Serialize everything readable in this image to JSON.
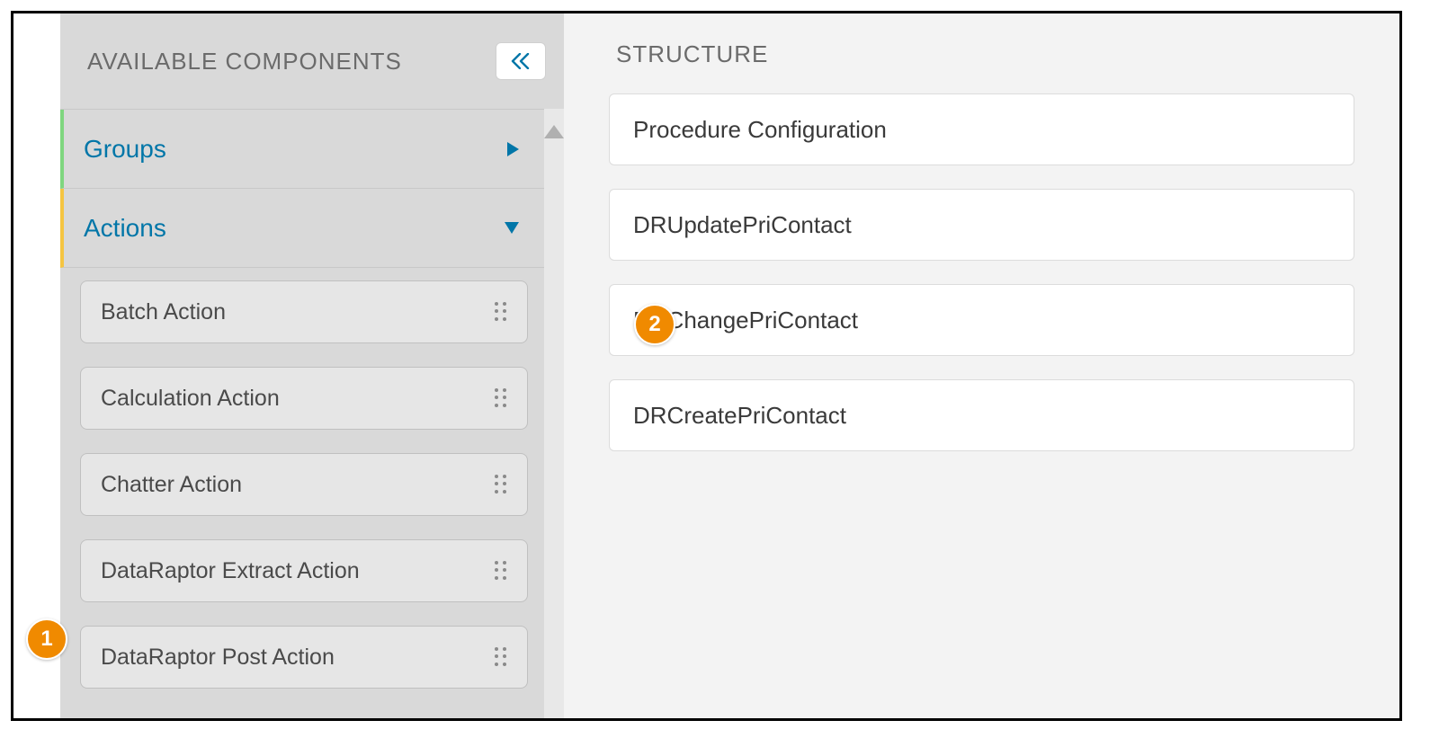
{
  "sidebar": {
    "title": "AVAILABLE COMPONENTS",
    "sections": {
      "groups": {
        "label": "Groups",
        "expanded": false
      },
      "actions": {
        "label": "Actions",
        "expanded": true,
        "items": [
          {
            "label": "Batch Action"
          },
          {
            "label": "Calculation Action"
          },
          {
            "label": "Chatter Action"
          },
          {
            "label": "DataRaptor Extract Action"
          },
          {
            "label": "DataRaptor Post Action"
          }
        ]
      }
    }
  },
  "structure": {
    "title": "STRUCTURE",
    "items": [
      {
        "label": "Procedure Configuration"
      },
      {
        "label": "DRUpdatePriContact"
      },
      {
        "label": "DRChangePriContact"
      },
      {
        "label": "DRCreatePriContact"
      }
    ]
  },
  "callouts": {
    "one": "1",
    "two": "2"
  },
  "colors": {
    "accent_link": "#0176a8",
    "callout": "#f08a00",
    "groups_stripe": "#7fd67f",
    "actions_stripe": "#f5c542"
  }
}
